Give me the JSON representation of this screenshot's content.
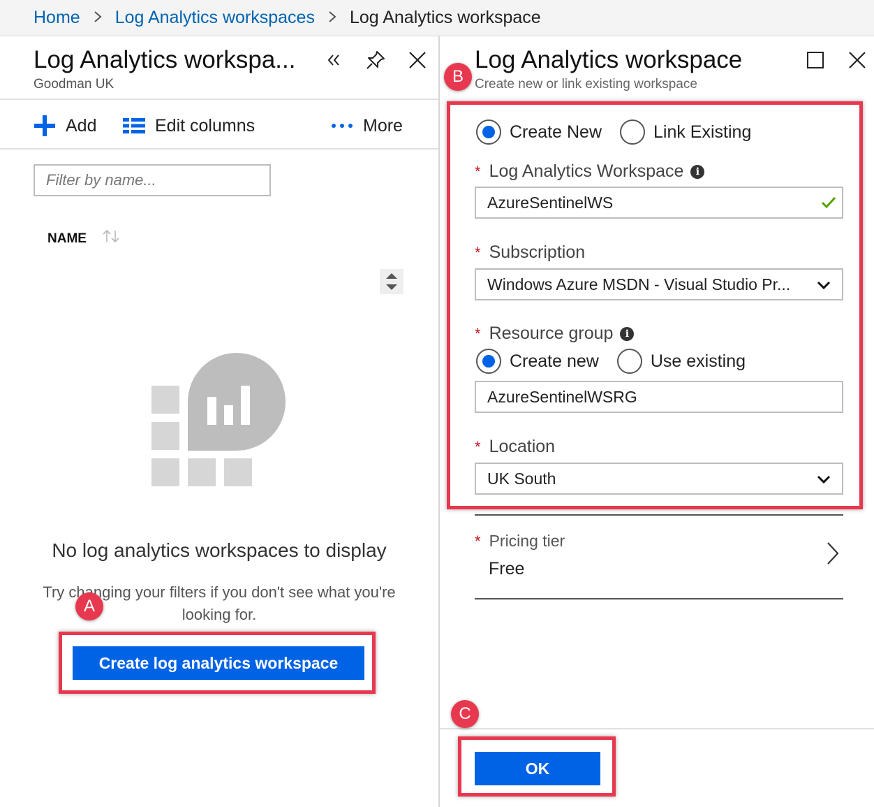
{
  "breadcrumb": {
    "items": [
      "Home",
      "Log Analytics workspaces",
      "Log Analytics workspace"
    ]
  },
  "left_blade": {
    "title": "Log Analytics workspa...",
    "subtitle": "Goodman UK",
    "commands": {
      "add": "Add",
      "edit_columns": "Edit columns",
      "more": "More"
    },
    "filter_placeholder": "Filter by name...",
    "column_header": "NAME",
    "empty_title": "No log analytics workspaces to display",
    "empty_hint": "Try changing your filters if you don't see what you're looking for.",
    "create_button": "Create log analytics workspace"
  },
  "right_blade": {
    "title": "Log Analytics workspace",
    "subtitle": "Create new or link existing workspace",
    "mode_options": [
      {
        "label": "Create New",
        "selected": true
      },
      {
        "label": "Link Existing",
        "selected": false
      }
    ],
    "workspace": {
      "label": "Log Analytics Workspace",
      "value": "AzureSentinelWS"
    },
    "subscription": {
      "label": "Subscription",
      "value": "Windows Azure MSDN - Visual Studio Pr..."
    },
    "resource_group": {
      "label": "Resource group",
      "options": [
        {
          "label": "Create new",
          "selected": true
        },
        {
          "label": "Use existing",
          "selected": false
        }
      ],
      "value": "AzureSentinelWSRG"
    },
    "location": {
      "label": "Location",
      "value": "UK South"
    },
    "pricing_tier": {
      "label": "Pricing tier",
      "value": "Free"
    },
    "ok_button": "OK"
  },
  "annotations": {
    "a": "A",
    "b": "B",
    "c": "C"
  },
  "colors": {
    "accent": "#0063e6",
    "link": "#0063b1",
    "highlight": "#e8384f",
    "success": "#57a300"
  },
  "icons": [
    "chevron-right-icon",
    "collapse-icon",
    "pin-icon",
    "close-icon",
    "plus-icon",
    "edit-columns-icon",
    "more-icon",
    "sort-icon",
    "maximize-icon",
    "info-icon",
    "checkmark-icon",
    "chevron-down-icon"
  ]
}
